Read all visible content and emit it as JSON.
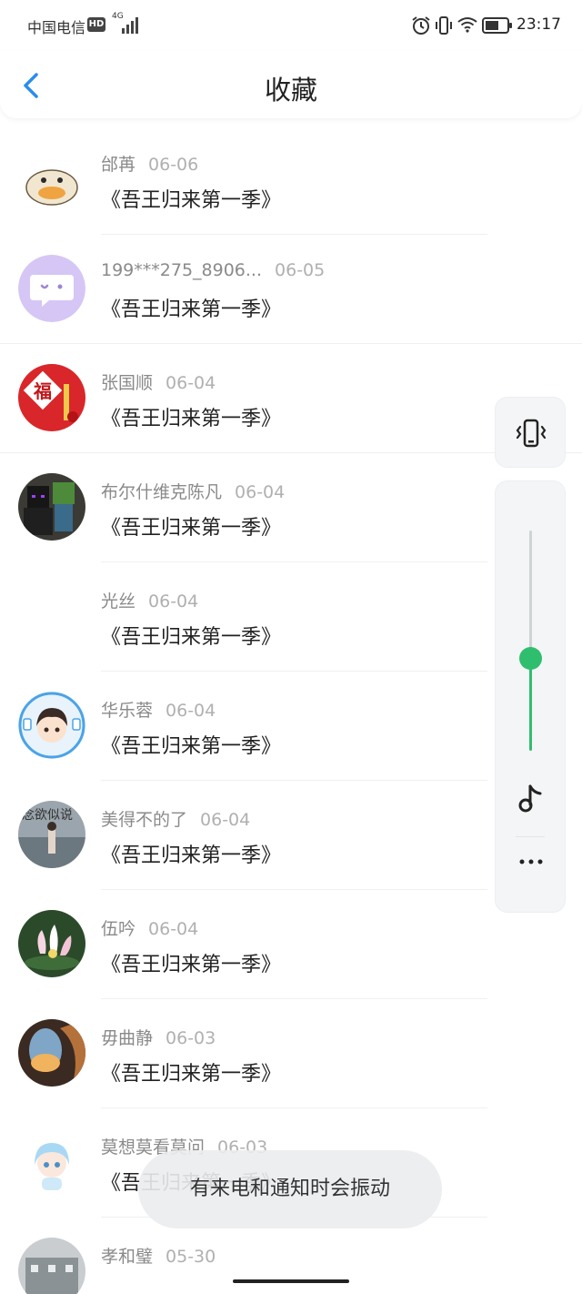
{
  "status_bar": {
    "carrier": "中国电信",
    "hd": "HD",
    "network": "4G",
    "time": "23:17"
  },
  "header": {
    "title": "收藏",
    "back_icon": "chevron-left-icon"
  },
  "items": [
    {
      "name": "邰苒",
      "date": "06-06",
      "title": "《吾王归来第一季》",
      "avatar": "duck"
    },
    {
      "name": "199***275_8906...",
      "date": "06-05",
      "title": "《吾王归来第一季》",
      "avatar": "purple-chat"
    },
    {
      "name": "张国顺",
      "date": "06-04",
      "title": "《吾王归来第一季》",
      "avatar": "red-fu"
    },
    {
      "name": "布尔什维克陈凡",
      "date": "06-04",
      "title": "《吾王归来第一季》",
      "avatar": "blocky-figure"
    },
    {
      "name": "光丝",
      "date": "06-04",
      "title": "《吾王归来第一季》",
      "avatar": "none"
    },
    {
      "name": "华乐蓉",
      "date": "06-04",
      "title": "《吾王归来第一季》",
      "avatar": "birthday-cartoon"
    },
    {
      "name": "美得不的了",
      "date": "06-04",
      "title": "《吾王归来第一季》",
      "avatar": "person-sea"
    },
    {
      "name": "伍吟",
      "date": "06-04",
      "title": "《吾王归来第一季》",
      "avatar": "lotus"
    },
    {
      "name": "毋曲静",
      "date": "06-03",
      "title": "《吾王归来第一季》",
      "avatar": "window-sunset"
    },
    {
      "name": "莫想莫看莫问",
      "date": "06-03",
      "title": "《吾王归来第一季》",
      "avatar": "anime-girl"
    },
    {
      "name": "孝和璧",
      "date": "05-30",
      "title": "",
      "avatar": "building"
    }
  ],
  "avatar_text": {
    "person_sea": "念欲似说"
  },
  "volume_panel": {
    "level": 0.42,
    "vibrate_icon": "vibrate-icon",
    "music_icon": "music-note-icon",
    "more_icon": "more-horizontal-icon"
  },
  "toast": {
    "text": "有来电和通知时会振动"
  },
  "colors": {
    "accent_blue": "#2a8cf0",
    "volume_green": "#2fbe6e"
  }
}
